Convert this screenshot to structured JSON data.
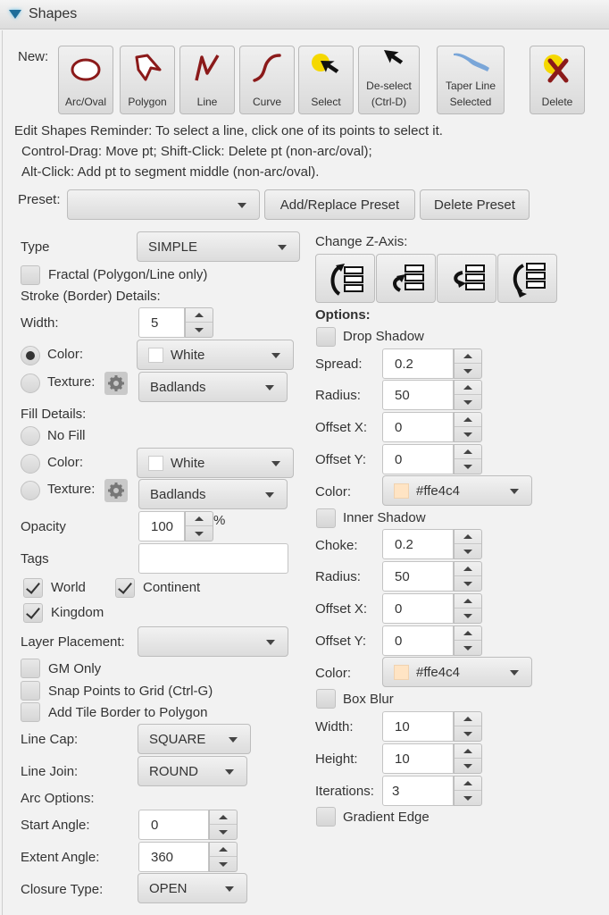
{
  "header": {
    "title": "Shapes",
    "collapse_icon": "triangle-down-icon"
  },
  "toolbar": {
    "new_label": "New:",
    "buttons": [
      {
        "label": "Arc/Oval",
        "icon": "oval-icon"
      },
      {
        "label": "Polygon",
        "icon": "polygon-icon"
      },
      {
        "label": "Line",
        "icon": "line-icon"
      },
      {
        "label": "Curve",
        "icon": "curve-icon"
      },
      {
        "label": "Select",
        "icon": "select-cursor-icon"
      },
      {
        "label_line1": "De-select",
        "label_line2": "(Ctrl-D)",
        "icon": "deselect-cursor-icon"
      },
      {
        "label_line1": "Taper Line",
        "label_line2": "Selected",
        "icon": "taper-line-icon"
      },
      {
        "label": "Delete",
        "icon": "delete-x-icon"
      }
    ]
  },
  "reminder": {
    "line1": "Edit Shapes Reminder: To select a line, click one of its points to select it.",
    "line2": "Control-Drag: Move pt; Shift-Click: Delete pt (non-arc/oval);",
    "line3": "Alt-Click: Add pt to segment middle (non-arc/oval)."
  },
  "preset": {
    "label": "Preset:",
    "value": "",
    "add_replace_label": "Add/Replace Preset",
    "delete_label": "Delete Preset"
  },
  "left": {
    "type_label": "Type",
    "type_value": "SIMPLE",
    "fractal_label": "Fractal (Polygon/Line only)",
    "fractal_checked": false,
    "stroke_header": "Stroke (Border) Details:",
    "width_label": "Width:",
    "width_value": "5",
    "stroke_color_label": "Color:",
    "stroke_color_selected": true,
    "stroke_color_value": "White",
    "stroke_texture_label": "Texture:",
    "stroke_texture_value": "Badlands",
    "fill_header": "Fill Details:",
    "no_fill_label": "No Fill",
    "fill_color_label": "Color:",
    "fill_color_value": "White",
    "fill_texture_label": "Texture:",
    "fill_texture_value": "Badlands",
    "opacity_label": "Opacity",
    "opacity_value": "100",
    "opacity_unit": "%",
    "tags_label": "Tags",
    "tags_value": "",
    "world_label": "World",
    "world_checked": true,
    "continent_label": "Continent",
    "continent_checked": true,
    "kingdom_label": "Kingdom",
    "kingdom_checked": true,
    "layer_label": "Layer Placement:",
    "layer_value": "",
    "gm_only_label": "GM Only",
    "snap_label": "Snap Points to Grid (Ctrl-G)",
    "tile_border_label": "Add Tile Border to Polygon",
    "line_cap_label": "Line Cap:",
    "line_cap_value": "SQUARE",
    "line_join_label": "Line Join:",
    "line_join_value": "ROUND",
    "arc_header": "Arc Options:",
    "start_angle_label": "Start Angle:",
    "start_angle_value": "0",
    "extent_angle_label": "Extent Angle:",
    "extent_angle_value": "360",
    "closure_label": "Closure Type:",
    "closure_value": "OPEN"
  },
  "right": {
    "z_axis_label": "Change Z-Axis:",
    "z_buttons": [
      "bring-to-front-icon",
      "bring-forward-icon",
      "send-backward-icon",
      "send-to-back-icon"
    ],
    "options_label": "Options:",
    "drop_shadow_label": "Drop Shadow",
    "drop_shadow": {
      "spread_label": "Spread:",
      "spread_value": "0.2",
      "radius_label": "Radius:",
      "radius_value": "50",
      "offset_x_label": "Offset X:",
      "offset_x_value": "0",
      "offset_y_label": "Offset Y:",
      "offset_y_value": "0",
      "color_label": "Color:",
      "color_value": "#ffe4c4"
    },
    "inner_shadow_label": "Inner Shadow",
    "inner_shadow": {
      "choke_label": "Choke:",
      "choke_value": "0.2",
      "radius_label": "Radius:",
      "radius_value": "50",
      "offset_x_label": "Offset X:",
      "offset_x_value": "0",
      "offset_y_label": "Offset Y:",
      "offset_y_value": "0",
      "color_label": "Color:",
      "color_value": "#ffe4c4"
    },
    "box_blur_label": "Box Blur",
    "box_blur": {
      "width_label": "Width:",
      "width_value": "10",
      "height_label": "Height:",
      "height_value": "10",
      "iterations_label": "Iterations:",
      "iterations_value": "3"
    },
    "gradient_edge_label": "Gradient Edge"
  },
  "colors": {
    "shape_stroke": "#8b1a1a",
    "select_yellow": "#f5d800",
    "taper_blue": "#7aa6d8",
    "shadow_swatch": "#ffe4c4"
  }
}
